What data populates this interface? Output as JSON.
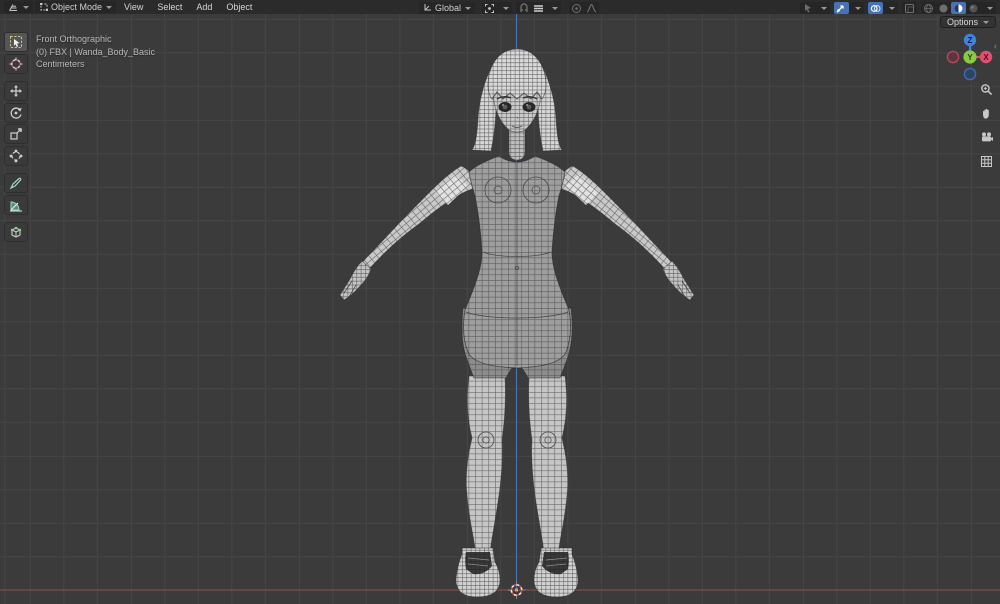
{
  "header": {
    "editor_icon": "3d-viewport-editor-icon",
    "mode": {
      "label": "Object Mode"
    },
    "menus": [
      {
        "label": "View"
      },
      {
        "label": "Select"
      },
      {
        "label": "Add"
      },
      {
        "label": "Object"
      }
    ],
    "orientation": {
      "label": "Global"
    },
    "right_icons": [
      "object-visibility",
      "show-gizmos",
      "show-overlays",
      "toggle-xray",
      "shading-wireframe",
      "shading-solid",
      "shading-material-preview",
      "shading-rendered"
    ],
    "active_shading": "material-preview",
    "options_label": "Options"
  },
  "toolbar": {
    "tools": [
      "select-box",
      "cursor-3d",
      "move",
      "rotate",
      "scale",
      "transform",
      "annotate",
      "measure",
      "add-cube"
    ],
    "active_tool": "select-box"
  },
  "viewport": {
    "overlay": {
      "line1": "Front Orthographic",
      "line2": "(0) FBX | Wanda_Body_Basic",
      "line3": "Centimeters"
    },
    "gizmo": {
      "x_label": "X",
      "y_label": "Y",
      "z_label": "Z"
    },
    "colors": {
      "background": "#3b3b3b",
      "grid": "#464646",
      "axis_x_line": "#9b4a47",
      "axis_z_line": "#4b74b8",
      "accent_blue": "#4772b3",
      "gizmo_x": "#e0506e",
      "gizmo_y": "#8acc3f",
      "gizmo_z": "#3f83dd",
      "model_light": "#c9c9c9",
      "model_suit": "#9e9e9e"
    }
  }
}
